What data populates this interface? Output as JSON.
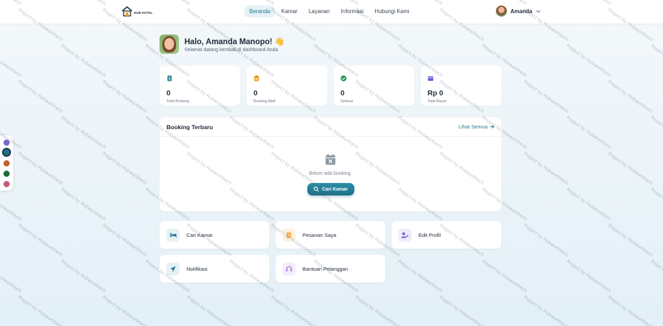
{
  "brand": {
    "name": "HUB HOTEL"
  },
  "nav": {
    "items": [
      "Beranda",
      "Kamar",
      "Layanan",
      "Informasi",
      "Hubungi Kami"
    ],
    "active": "Beranda"
  },
  "user": {
    "name": "Amanda"
  },
  "greeting": {
    "title": "Halo, Amanda Manopo! 👋",
    "subtitle": "Selamat datang kembali di dashboard Anda"
  },
  "stats": [
    {
      "value": "0",
      "label": "Total Booking",
      "icon": "document-icon",
      "color": "#22798f"
    },
    {
      "value": "0",
      "label": "Booking Aktif",
      "icon": "clipboard-icon",
      "color": "#f0a030"
    },
    {
      "value": "0",
      "label": "Selesai",
      "icon": "check-circle-icon",
      "color": "#1f9a5a"
    },
    {
      "value": "Rp 0",
      "label": "Total Bayar",
      "icon": "wallet-icon",
      "color": "#6a5ad8"
    }
  ],
  "booking_panel": {
    "title": "Booking Terbaru",
    "view_all": "Lihat Semua",
    "empty_text": "Belum ada booking.",
    "search_button": "Cari Kamar"
  },
  "actions": [
    {
      "label": "Cari Kamar",
      "icon": "bed-icon",
      "color": "#22798f",
      "bg": "#e6f1f6"
    },
    {
      "label": "Pesanan Saya",
      "icon": "receipt-icon",
      "color": "#f0a030",
      "bg": "#fdf1e0"
    },
    {
      "label": "Edit Profil",
      "icon": "user-edit-icon",
      "color": "#6a5ad8",
      "bg": "#eeecfb"
    },
    {
      "label": "Notifikasi",
      "icon": "send-icon",
      "color": "#22798f",
      "bg": "#e6f1f6"
    },
    {
      "label": "Bantuan Pelanggan",
      "icon": "headset-icon",
      "color": "#9a5ad8",
      "bg": "#f3ecfb"
    }
  ],
  "theme_colors": [
    "#7b68c8",
    "#1f7088",
    "#c8602a",
    "#1f6a3a",
    "#c85a7a"
  ],
  "theme_selected": "#1f7088",
  "watermark": "Project by Hubworktech"
}
